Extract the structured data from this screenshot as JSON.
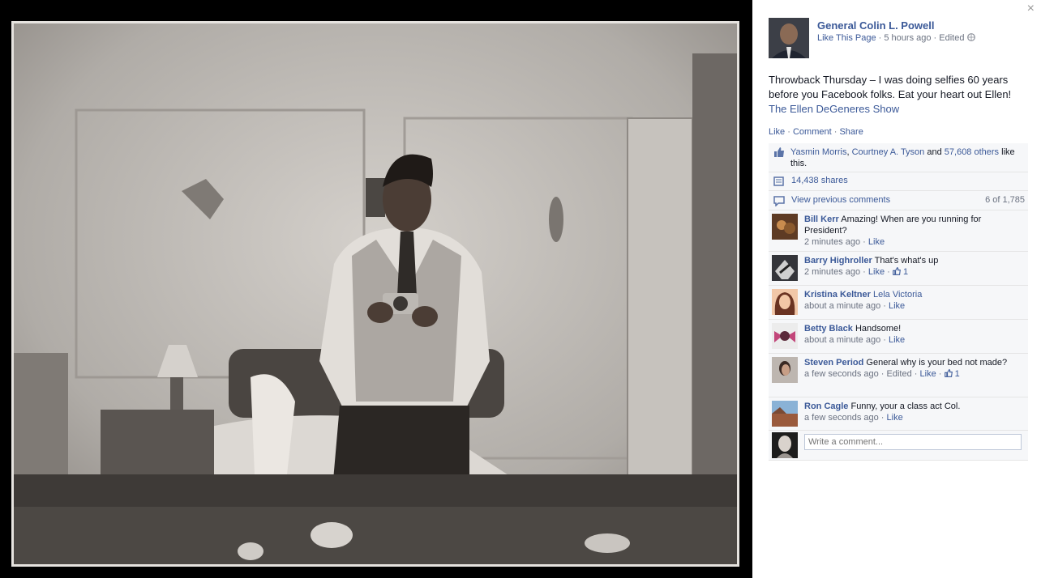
{
  "post": {
    "author": "General Colin L. Powell",
    "like_page": "Like This Page",
    "time": "5 hours ago",
    "edited": "Edited",
    "text": "Throwback Thursday – I was doing selfies 60 years before you Facebook folks. Eat your heart out Ellen!",
    "tag": "The Ellen DeGeneres Show"
  },
  "actions": {
    "like": "Like",
    "comment": "Comment",
    "share": "Share"
  },
  "likes": {
    "name1": "Yasmin Morris",
    "name2": "Courtney A. Tyson",
    "and": "and",
    "others": "57,608 others",
    "suffix": "like this."
  },
  "shares": "14,438 shares",
  "comments_nav": {
    "view_previous": "View previous comments",
    "count": "6 of 1,785"
  },
  "comments": [
    {
      "name": "Bill Kerr",
      "text": "Amazing! When are you running for President?",
      "time": "2 minutes ago",
      "like": "Like",
      "likes": ""
    },
    {
      "name": "Barry Highroller",
      "text": "That's what's up",
      "time": "2 minutes ago",
      "like": "Like",
      "likes": "1"
    },
    {
      "name": "Kristina Keltner",
      "text": "Lela Victoria",
      "time": "about a minute ago",
      "like": "Like",
      "likes": ""
    },
    {
      "name": "Betty Black",
      "text": "Handsome!",
      "time": "about a minute ago",
      "like": "Like",
      "likes": ""
    },
    {
      "name": "Steven Period",
      "text": "General why is your bed not made?",
      "time": "a few seconds ago",
      "edited": "Edited",
      "like": "Like",
      "likes": "1"
    },
    {
      "name": "Ron Cagle",
      "text": "Funny, your a class act Col.",
      "time": "a few seconds ago",
      "like": "Like",
      "likes": ""
    }
  ],
  "write_comment_placeholder": "Write a comment...",
  "icons": {
    "close": "×",
    "globe": "globe-icon",
    "thumb": "thumbs-up-icon",
    "share": "share-icon",
    "comment": "comment-icon"
  },
  "colors": {
    "link": "#3b5998",
    "meta": "#6a7180",
    "ufi_bg": "#f6f7f9"
  }
}
